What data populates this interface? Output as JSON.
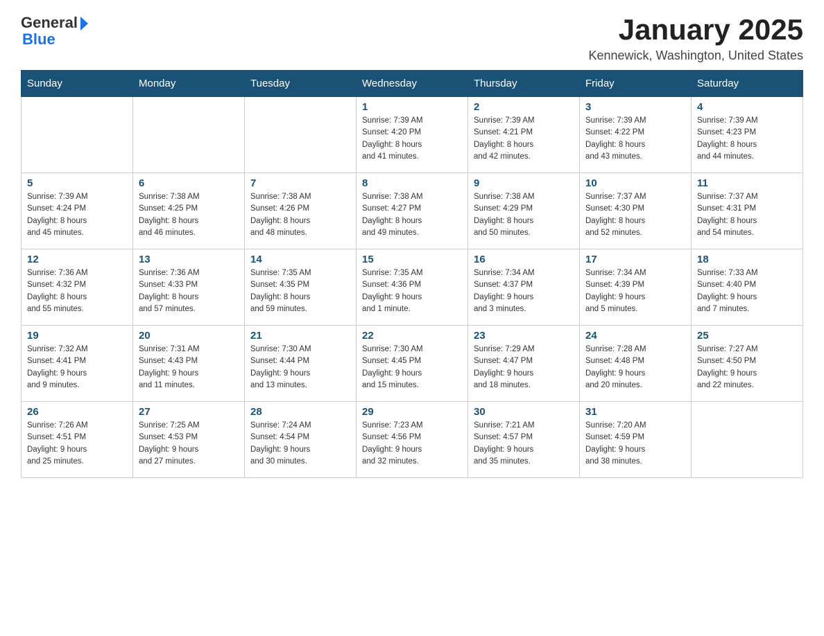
{
  "header": {
    "logo_general": "General",
    "logo_blue": "Blue",
    "title": "January 2025",
    "subtitle": "Kennewick, Washington, United States"
  },
  "days_of_week": [
    "Sunday",
    "Monday",
    "Tuesday",
    "Wednesday",
    "Thursday",
    "Friday",
    "Saturday"
  ],
  "weeks": [
    [
      {
        "day": "",
        "info": ""
      },
      {
        "day": "",
        "info": ""
      },
      {
        "day": "",
        "info": ""
      },
      {
        "day": "1",
        "info": "Sunrise: 7:39 AM\nSunset: 4:20 PM\nDaylight: 8 hours\nand 41 minutes."
      },
      {
        "day": "2",
        "info": "Sunrise: 7:39 AM\nSunset: 4:21 PM\nDaylight: 8 hours\nand 42 minutes."
      },
      {
        "day": "3",
        "info": "Sunrise: 7:39 AM\nSunset: 4:22 PM\nDaylight: 8 hours\nand 43 minutes."
      },
      {
        "day": "4",
        "info": "Sunrise: 7:39 AM\nSunset: 4:23 PM\nDaylight: 8 hours\nand 44 minutes."
      }
    ],
    [
      {
        "day": "5",
        "info": "Sunrise: 7:39 AM\nSunset: 4:24 PM\nDaylight: 8 hours\nand 45 minutes."
      },
      {
        "day": "6",
        "info": "Sunrise: 7:38 AM\nSunset: 4:25 PM\nDaylight: 8 hours\nand 46 minutes."
      },
      {
        "day": "7",
        "info": "Sunrise: 7:38 AM\nSunset: 4:26 PM\nDaylight: 8 hours\nand 48 minutes."
      },
      {
        "day": "8",
        "info": "Sunrise: 7:38 AM\nSunset: 4:27 PM\nDaylight: 8 hours\nand 49 minutes."
      },
      {
        "day": "9",
        "info": "Sunrise: 7:38 AM\nSunset: 4:29 PM\nDaylight: 8 hours\nand 50 minutes."
      },
      {
        "day": "10",
        "info": "Sunrise: 7:37 AM\nSunset: 4:30 PM\nDaylight: 8 hours\nand 52 minutes."
      },
      {
        "day": "11",
        "info": "Sunrise: 7:37 AM\nSunset: 4:31 PM\nDaylight: 8 hours\nand 54 minutes."
      }
    ],
    [
      {
        "day": "12",
        "info": "Sunrise: 7:36 AM\nSunset: 4:32 PM\nDaylight: 8 hours\nand 55 minutes."
      },
      {
        "day": "13",
        "info": "Sunrise: 7:36 AM\nSunset: 4:33 PM\nDaylight: 8 hours\nand 57 minutes."
      },
      {
        "day": "14",
        "info": "Sunrise: 7:35 AM\nSunset: 4:35 PM\nDaylight: 8 hours\nand 59 minutes."
      },
      {
        "day": "15",
        "info": "Sunrise: 7:35 AM\nSunset: 4:36 PM\nDaylight: 9 hours\nand 1 minute."
      },
      {
        "day": "16",
        "info": "Sunrise: 7:34 AM\nSunset: 4:37 PM\nDaylight: 9 hours\nand 3 minutes."
      },
      {
        "day": "17",
        "info": "Sunrise: 7:34 AM\nSunset: 4:39 PM\nDaylight: 9 hours\nand 5 minutes."
      },
      {
        "day": "18",
        "info": "Sunrise: 7:33 AM\nSunset: 4:40 PM\nDaylight: 9 hours\nand 7 minutes."
      }
    ],
    [
      {
        "day": "19",
        "info": "Sunrise: 7:32 AM\nSunset: 4:41 PM\nDaylight: 9 hours\nand 9 minutes."
      },
      {
        "day": "20",
        "info": "Sunrise: 7:31 AM\nSunset: 4:43 PM\nDaylight: 9 hours\nand 11 minutes."
      },
      {
        "day": "21",
        "info": "Sunrise: 7:30 AM\nSunset: 4:44 PM\nDaylight: 9 hours\nand 13 minutes."
      },
      {
        "day": "22",
        "info": "Sunrise: 7:30 AM\nSunset: 4:45 PM\nDaylight: 9 hours\nand 15 minutes."
      },
      {
        "day": "23",
        "info": "Sunrise: 7:29 AM\nSunset: 4:47 PM\nDaylight: 9 hours\nand 18 minutes."
      },
      {
        "day": "24",
        "info": "Sunrise: 7:28 AM\nSunset: 4:48 PM\nDaylight: 9 hours\nand 20 minutes."
      },
      {
        "day": "25",
        "info": "Sunrise: 7:27 AM\nSunset: 4:50 PM\nDaylight: 9 hours\nand 22 minutes."
      }
    ],
    [
      {
        "day": "26",
        "info": "Sunrise: 7:26 AM\nSunset: 4:51 PM\nDaylight: 9 hours\nand 25 minutes."
      },
      {
        "day": "27",
        "info": "Sunrise: 7:25 AM\nSunset: 4:53 PM\nDaylight: 9 hours\nand 27 minutes."
      },
      {
        "day": "28",
        "info": "Sunrise: 7:24 AM\nSunset: 4:54 PM\nDaylight: 9 hours\nand 30 minutes."
      },
      {
        "day": "29",
        "info": "Sunrise: 7:23 AM\nSunset: 4:56 PM\nDaylight: 9 hours\nand 32 minutes."
      },
      {
        "day": "30",
        "info": "Sunrise: 7:21 AM\nSunset: 4:57 PM\nDaylight: 9 hours\nand 35 minutes."
      },
      {
        "day": "31",
        "info": "Sunrise: 7:20 AM\nSunset: 4:59 PM\nDaylight: 9 hours\nand 38 minutes."
      },
      {
        "day": "",
        "info": ""
      }
    ]
  ]
}
